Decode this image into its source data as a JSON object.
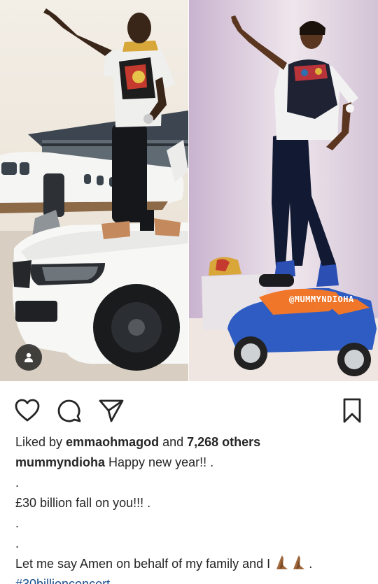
{
  "post": {
    "watermark": "@MUMMYNDIOHA"
  },
  "actions": {
    "like_icon": "heart-icon",
    "comment_icon": "comment-icon",
    "share_icon": "paper-plane-icon",
    "save_icon": "bookmark-icon"
  },
  "likes": {
    "prefix": "Liked by ",
    "user": "emmaohmagod",
    "middle": " and ",
    "count": "7,268 others"
  },
  "caption": {
    "username": "mummyndioha",
    "text": " Happy new year!! .",
    "dot1": ".",
    "line2": "£30 billion fall on you!!! .",
    "dot2": ".",
    "dot3": ".",
    "line3": "Let me say Amen on behalf of my family and I",
    "line3_end": ".",
    "emoji_icon": "praying-hands-icon",
    "hashtag": "#30billionconcert"
  },
  "colors": {
    "text": "#262626",
    "hashtag": "#1a4f8a"
  }
}
